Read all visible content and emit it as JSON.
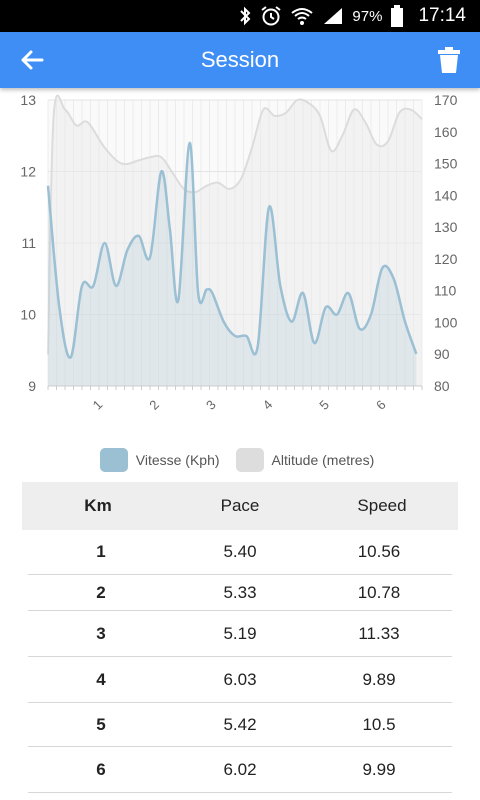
{
  "status_bar": {
    "battery_percent": "97%",
    "time": "17:14"
  },
  "app_bar": {
    "title": "Session",
    "back_icon": "arrow-left-icon",
    "delete_icon": "trash-icon",
    "color": "#3f8ef5"
  },
  "chart_data": {
    "type": "area",
    "x_ticks": [
      "1",
      "2",
      "3",
      "4",
      "5",
      "6"
    ],
    "y_left_ticks": [
      "9",
      "10",
      "11",
      "12",
      "13"
    ],
    "y_right_ticks": [
      "80",
      "90",
      "100",
      "110",
      "120",
      "130",
      "140",
      "150",
      "160",
      "170"
    ],
    "y_left_range": [
      9,
      13
    ],
    "y_right_range": [
      80,
      170
    ],
    "x_range": [
      0,
      6.6
    ],
    "grid": true,
    "legend_position": "bottom",
    "series": [
      {
        "name": "Vitesse (Kph)",
        "axis": "left",
        "color": "#9bbfd3",
        "x": [
          0,
          0.2,
          0.4,
          0.6,
          0.8,
          1.0,
          1.2,
          1.4,
          1.6,
          1.8,
          2.0,
          2.15,
          2.3,
          2.5,
          2.65,
          2.8,
          2.9,
          3.1,
          3.3,
          3.5,
          3.7,
          3.9,
          4.1,
          4.3,
          4.5,
          4.7,
          4.9,
          5.1,
          5.3,
          5.5,
          5.7,
          5.9,
          6.1,
          6.3,
          6.5
        ],
        "y": [
          11.8,
          10.1,
          9.4,
          10.4,
          10.4,
          11.0,
          10.4,
          10.9,
          11.1,
          10.8,
          12.0,
          11.2,
          10.2,
          12.4,
          10.3,
          10.35,
          10.3,
          9.9,
          9.7,
          9.7,
          9.55,
          11.5,
          10.4,
          9.9,
          10.3,
          9.6,
          10.1,
          10.0,
          10.3,
          9.8,
          10.0,
          10.65,
          10.5,
          9.9,
          9.45
        ]
      },
      {
        "name": "Altitude (metres)",
        "axis": "right",
        "color": "#dddddd",
        "x": [
          0,
          0.1,
          0.3,
          0.5,
          0.7,
          1.0,
          1.3,
          1.6,
          1.8,
          2.0,
          2.2,
          2.4,
          2.6,
          2.8,
          3.0,
          3.2,
          3.4,
          3.6,
          3.8,
          4.0,
          4.2,
          4.4,
          4.6,
          4.8,
          5.0,
          5.2,
          5.4,
          5.6,
          5.8,
          6.0,
          6.2,
          6.4,
          6.6
        ],
        "y": [
          90,
          165,
          167,
          162,
          163,
          155,
          150,
          151,
          152,
          152,
          147,
          142,
          141,
          143,
          144,
          142,
          145,
          155,
          167,
          165,
          166,
          170,
          169,
          165,
          154,
          159,
          167,
          163,
          156,
          157,
          166,
          167,
          164
        ]
      }
    ]
  },
  "table": {
    "headers": [
      "Km",
      "Pace",
      "Speed"
    ],
    "rows": [
      [
        "1",
        "5.40",
        "10.56"
      ],
      [
        "2",
        "5.33",
        "10.78"
      ],
      [
        "3",
        "5.19",
        "11.33"
      ],
      [
        "4",
        "6.03",
        "9.89"
      ],
      [
        "5",
        "5.42",
        "10.5"
      ],
      [
        "6",
        "6.02",
        "9.99"
      ]
    ]
  }
}
